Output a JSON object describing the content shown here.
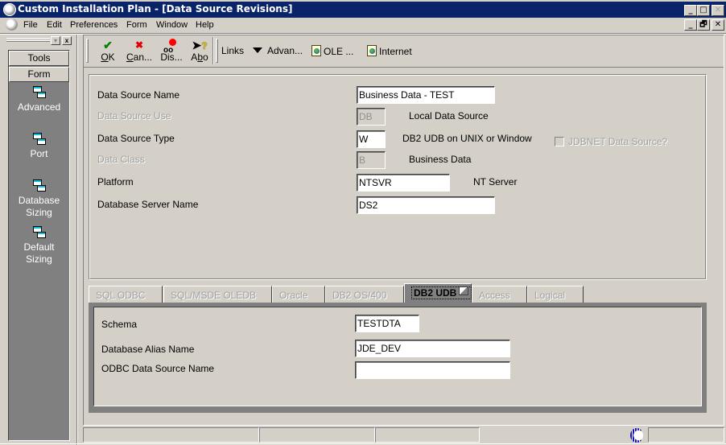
{
  "window": {
    "title": "Custom Installation Plan - [Data Source Revisions]",
    "controls": {
      "minimize": "_",
      "maximize": "□",
      "close": "✕"
    },
    "doc_controls": {
      "minimize": "_",
      "restore": "🗗",
      "close": "✕"
    }
  },
  "menu": {
    "items": [
      "File",
      "Edit",
      "Preferences",
      "Form",
      "Window",
      "Help"
    ]
  },
  "sidebar": {
    "dropdown_glyph": "▾",
    "close_glyph": "x",
    "tabs": [
      "Tools",
      "Form"
    ],
    "items": [
      {
        "label_line1": "Advanced",
        "label_line2": "",
        "icon": "form-exit-icon"
      },
      {
        "label_line1": "Port",
        "label_line2": "",
        "icon": "form-exit-icon"
      },
      {
        "label_line1": "Database",
        "label_line2": "Sizing",
        "icon": "form-exit-icon"
      },
      {
        "label_line1": "Default",
        "label_line2": "Sizing",
        "icon": "form-exit-icon"
      }
    ]
  },
  "toolbar": {
    "buttons": [
      {
        "id": "ok",
        "glyph": "✔",
        "accel": "O",
        "rest": "K",
        "color": "#008000"
      },
      {
        "id": "cancel",
        "glyph": "✖",
        "accel": "C",
        "rest": "an...",
        "color": "#e00000"
      },
      {
        "id": "display",
        "glyph": "👓",
        "accel": "",
        "rest": "Dis...",
        "color": "#e00000"
      },
      {
        "id": "about",
        "glyph": "?",
        "accel": "",
        "rest": "Abo",
        "color": "#000000"
      }
    ],
    "links_label": "Links",
    "advanced_label": "Advan...",
    "ole_label": "OLE ...",
    "internet_label": "Internet"
  },
  "header": {
    "fields": {
      "data_source_name": {
        "label": "Data Source Name",
        "value": "Business Data - TEST"
      },
      "data_source_use": {
        "label": "Data Source Use",
        "value": "DB",
        "description": "Local Data Source",
        "disabled": true
      },
      "data_source_type": {
        "label": "Data Source Type",
        "value": "W",
        "description": "DB2 UDB on UNIX or Window"
      },
      "data_class": {
        "label": "Data Class",
        "value": "B",
        "description": "Business Data",
        "disabled": true
      },
      "platform": {
        "label": "Platform",
        "value": "NTSVR",
        "description": "NT Server"
      },
      "database_server_name": {
        "label": "Database Server Name",
        "value": "DS2"
      }
    },
    "jdbnet_checkbox": {
      "label": "JDBNET Data Source?",
      "checked": false,
      "disabled": true
    }
  },
  "tabs": {
    "items": [
      "SQL ODBC",
      "SQL/MSDE OLEDB",
      "Oracle",
      "DB2 OS/400",
      "DB2 UDB",
      "Access",
      "Logical"
    ],
    "active": "DB2 UDB"
  },
  "db2udb": {
    "schema": {
      "label": "Schema",
      "value": "TESTDTA"
    },
    "database_alias_name": {
      "label": "Database Alias Name",
      "value": "JDE_DEV"
    },
    "odbc_data_source_name": {
      "label": "ODBC Data Source Name",
      "value": ""
    }
  },
  "statusbar": {
    "cells": [
      "",
      "",
      ""
    ]
  }
}
